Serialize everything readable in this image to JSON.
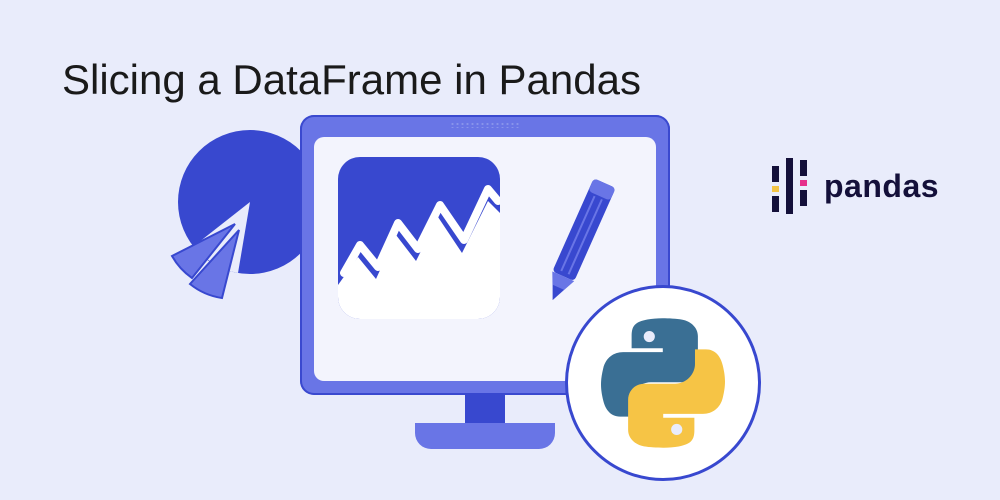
{
  "title": "Slicing a DataFrame in Pandas",
  "pandas_label": "pandas",
  "colors": {
    "bg": "#e9ecfb",
    "primary_blue": "#3848cf",
    "light_blue": "#6975e6",
    "screen": "#f3f4fd",
    "python_blue": "#3a6f94",
    "python_yellow": "#f6c445",
    "pandas_pink": "#e62f8b",
    "pandas_yellow": "#f3c445",
    "pandas_dark": "#14103a"
  }
}
